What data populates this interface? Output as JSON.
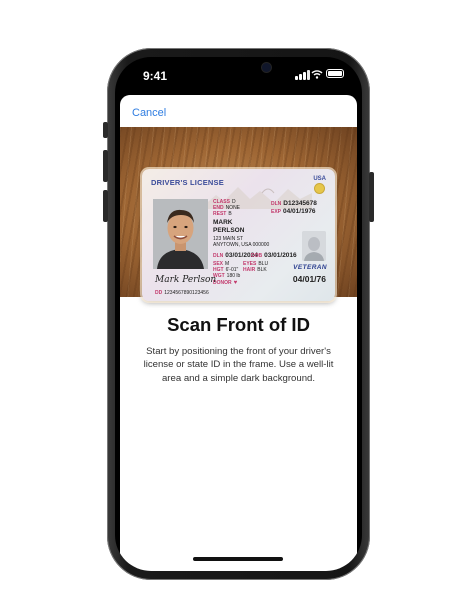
{
  "status_bar": {
    "time": "9:41"
  },
  "nav": {
    "cancel_label": "Cancel"
  },
  "license": {
    "header": "DRIVER'S LICENSE",
    "country": "USA",
    "class_label": "CLASS",
    "class_value": "D",
    "end_label": "END",
    "end_value": "NONE",
    "rest_label": "REST",
    "rest_value": "B",
    "dln_label": "DLN",
    "dln_value": "D12345678",
    "exp_label": "EXP",
    "exp_value": "04/01/1976",
    "first_name": "MARK",
    "last_name": "PERLSON",
    "address_line1": "123 MAIN ST",
    "address_line2": "ANYTOWN, USA 000000",
    "iss_label": "DLN",
    "iss_value": "03/01/2024",
    "dob_label": "DOB",
    "dob_value": "03/01/2016",
    "sex_label": "SEX",
    "sex_value": "M",
    "eyes_label": "EYES",
    "eyes_value": "BLU",
    "hgt_label": "HGT",
    "hgt_value": "6'-01\"",
    "hair_label": "HAIR",
    "hair_value": "BLK",
    "wgt_label": "WGT",
    "wgt_value": "180 lb",
    "donor_label": "DONOR",
    "dd_label": "DD",
    "dd_value": "1234567890123456",
    "veteran": "VETERAN",
    "dob_large": "04/01/76",
    "signature": "Mark Perlson"
  },
  "content": {
    "title": "Scan Front of ID",
    "description": "Start by positioning the front of your driver's license or state ID in the frame. Use a well-lit area and a simple dark background."
  },
  "colors": {
    "accent": "#2f7de1",
    "license_label": "#c2386b",
    "license_header": "#3b4c9a"
  }
}
